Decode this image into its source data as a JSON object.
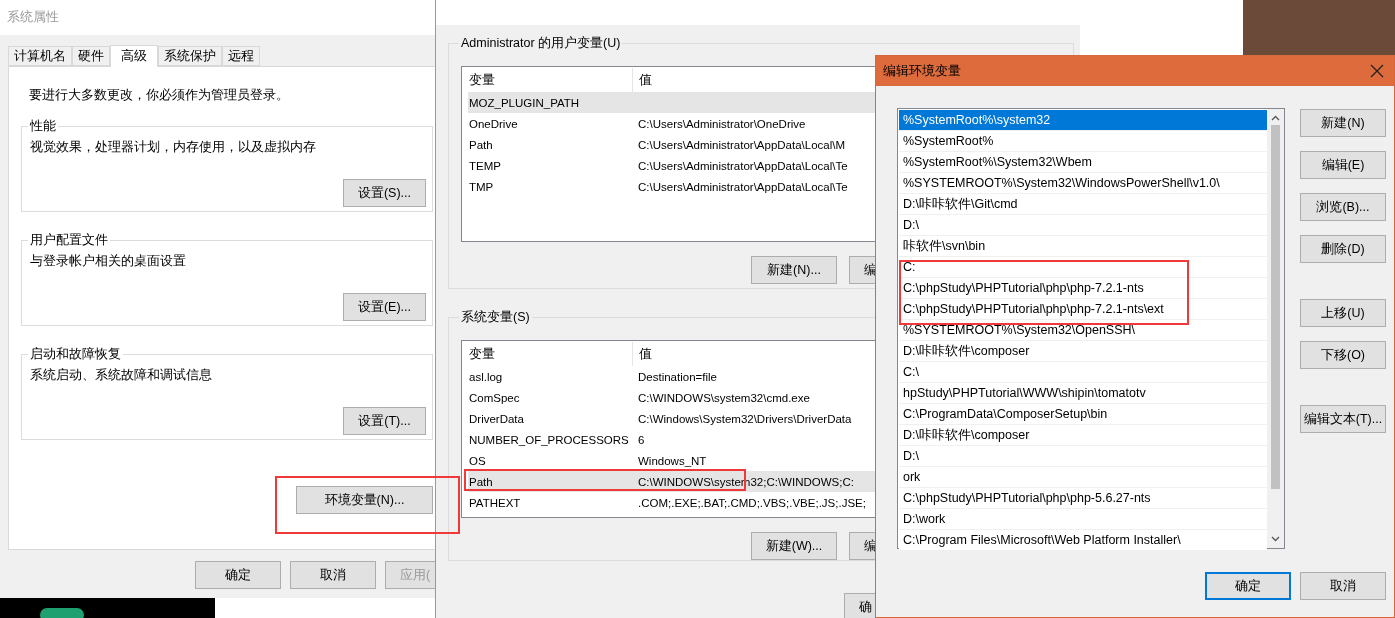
{
  "system_properties": {
    "title": "系统属性",
    "tabs": [
      {
        "label": "计算机名",
        "selected": false
      },
      {
        "label": "硬件",
        "selected": false
      },
      {
        "label": "高级",
        "selected": true
      },
      {
        "label": "系统保护",
        "selected": false
      },
      {
        "label": "远程",
        "selected": false
      }
    ],
    "notice": "要进行大多数更改，你必须作为管理员登录。",
    "groups": [
      {
        "title": "性能",
        "description": "视觉效果，处理器计划，内存使用，以及虚拟内存",
        "button": "设置(S)..."
      },
      {
        "title": "用户配置文件",
        "description": "与登录帐户相关的桌面设置",
        "button": "设置(E)..."
      },
      {
        "title": "启动和故障恢复",
        "description": "系统启动、系统故障和调试信息",
        "button": "设置(T)..."
      }
    ],
    "env_button": "环境变量(N)...",
    "buttons": [
      {
        "label": "确定",
        "disabled": false
      },
      {
        "label": "取消",
        "disabled": false
      },
      {
        "label": "应用(",
        "disabled": true
      }
    ]
  },
  "environment_variables": {
    "user_group": {
      "title": "Administrator 的用户变量(U)",
      "columns": [
        "变量",
        "值"
      ],
      "rows": [
        {
          "name": "MOZ_PLUGIN_PATH",
          "value": "",
          "selected": true
        },
        {
          "name": "OneDrive",
          "value": "C:\\Users\\Administrator\\OneDrive",
          "selected": false
        },
        {
          "name": "Path",
          "value": "C:\\Users\\Administrator\\AppData\\Local\\M",
          "selected": false
        },
        {
          "name": "TEMP",
          "value": "C:\\Users\\Administrator\\AppData\\Local\\Te",
          "selected": false
        },
        {
          "name": "TMP",
          "value": "C:\\Users\\Administrator\\AppData\\Local\\Te",
          "selected": false
        }
      ],
      "buttons": [
        "新建(N)...",
        "编"
      ]
    },
    "system_group": {
      "title": "系统变量(S)",
      "columns": [
        "变量",
        "值"
      ],
      "rows": [
        {
          "name": "asl.log",
          "value": "Destination=file",
          "selected": false
        },
        {
          "name": "ComSpec",
          "value": "C:\\WINDOWS\\system32\\cmd.exe",
          "selected": false
        },
        {
          "name": "DriverData",
          "value": "C:\\Windows\\System32\\Drivers\\DriverData",
          "selected": false
        },
        {
          "name": "NUMBER_OF_PROCESSORS",
          "value": "6",
          "selected": false
        },
        {
          "name": "OS",
          "value": "Windows_NT",
          "selected": false
        },
        {
          "name": "Path",
          "value": "C:\\WINDOWS\\system32;C:\\WINDOWS;C:",
          "selected": true
        },
        {
          "name": "PATHEXT",
          "value": ".COM;.EXE;.BAT;.CMD;.VBS;.VBE;.JS;.JSE;",
          "selected": false
        }
      ],
      "buttons": [
        "新建(W)...",
        "编"
      ]
    },
    "bottom_buttons": [
      "确"
    ]
  },
  "edit_dialog": {
    "title": "编辑环境变量",
    "items": [
      {
        "text": "%SystemRoot%\\system32",
        "selected": true
      },
      {
        "text": "%SystemRoot%",
        "selected": false
      },
      {
        "text": "%SystemRoot%\\System32\\Wbem",
        "selected": false
      },
      {
        "text": "%SYSTEMROOT%\\System32\\WindowsPowerShell\\v1.0\\",
        "selected": false
      },
      {
        "text": "D:\\咔咔软件\\Git\\cmd",
        "selected": false
      },
      {
        "text": "D:\\",
        "selected": false
      },
      {
        "text": "咔软件\\svn\\bin",
        "selected": false
      },
      {
        "text": "C:",
        "selected": false
      },
      {
        "text": "C:\\phpStudy\\PHPTutorial\\php\\php-7.2.1-nts",
        "selected": false
      },
      {
        "text": "C:\\phpStudy\\PHPTutorial\\php\\php-7.2.1-nts\\ext",
        "selected": false
      },
      {
        "text": "%SYSTEMROOT%\\System32\\OpenSSH\\",
        "selected": false
      },
      {
        "text": "D:\\咔咔软件\\composer",
        "selected": false
      },
      {
        "text": "C:\\",
        "selected": false
      },
      {
        "text": "hpStudy\\PHPTutorial\\WWW\\shipin\\tomatotv",
        "selected": false
      },
      {
        "text": "C:\\ProgramData\\ComposerSetup\\bin",
        "selected": false
      },
      {
        "text": "D:\\咔咔软件\\composer",
        "selected": false
      },
      {
        "text": "D:\\",
        "selected": false
      },
      {
        "text": "ork",
        "selected": false
      },
      {
        "text": "C:\\phpStudy\\PHPTutorial\\php\\php-5.6.27-nts",
        "selected": false
      },
      {
        "text": "D:\\work",
        "selected": false
      },
      {
        "text": "C:\\Program Files\\Microsoft\\Web Platform Installer\\",
        "selected": false
      }
    ],
    "side_buttons": [
      [
        "新建(N)",
        "编辑(E)",
        "浏览(B)...",
        "删除(D)"
      ],
      [
        "上移(U)",
        "下移(O)"
      ],
      [
        "编辑文本(T)..."
      ]
    ],
    "buttons": [
      {
        "label": "确定",
        "focused": true
      },
      {
        "label": "取消",
        "focused": false
      }
    ]
  }
}
